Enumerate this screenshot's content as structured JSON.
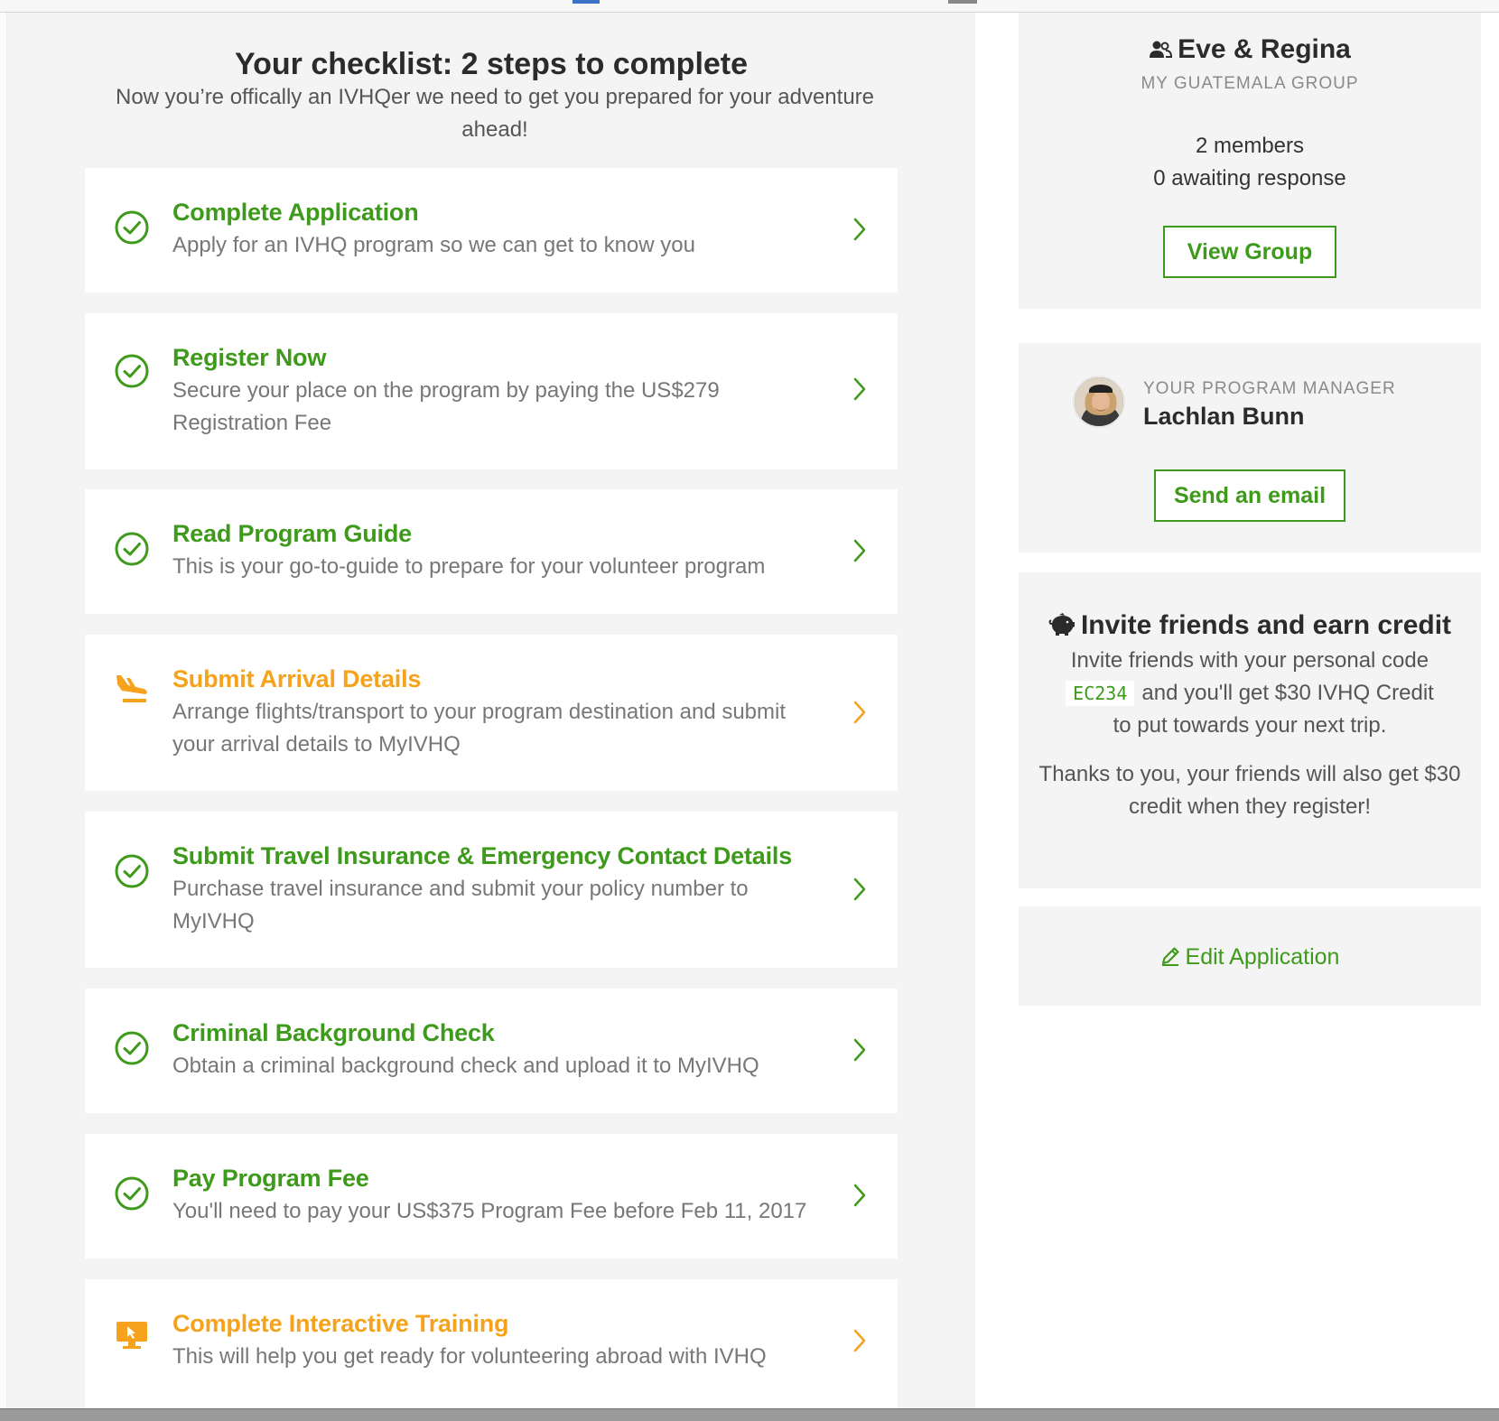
{
  "checklist": {
    "title": "Your checklist: 2 steps to complete",
    "subtitle": "Now you’re offically an IVHQer we need to get you prepared for your adventure ahead!",
    "items": [
      {
        "title": "Complete Application",
        "description": "Apply for an IVHQ program so we can get to know you",
        "status": "done"
      },
      {
        "title": "Register Now",
        "description": "Secure your place on the program by paying the US$279 Registration Fee",
        "status": "done"
      },
      {
        "title": "Read Program Guide",
        "description": "This is your go-to-guide to prepare for your volunteer program",
        "status": "done"
      },
      {
        "title": "Submit Arrival Details",
        "description": "Arrange flights/transport to your program destination and submit your arrival details to MyIVHQ",
        "status": "todo"
      },
      {
        "title": "Submit Travel Insurance & Emergency Contact Details",
        "description": "Purchase travel insurance and submit your policy number to MyIVHQ",
        "status": "done"
      },
      {
        "title": "Criminal Background Check",
        "description": "Obtain a criminal background check and upload it to MyIVHQ",
        "status": "done"
      },
      {
        "title": "Pay Program Fee",
        "description": "You'll need to pay your US$375 Program Fee before Feb 11, 2017",
        "status": "done"
      },
      {
        "title": "Complete Interactive Training",
        "description": "This will help you get ready for volunteering abroad with IVHQ",
        "status": "todo"
      }
    ]
  },
  "group": {
    "name": "Eve & Regina",
    "label": "MY GUATEMALA GROUP",
    "members": "2 members",
    "awaiting": "0 awaiting response",
    "button_label": "View Group"
  },
  "program_manager": {
    "label": "YOUR PROGRAM MANAGER",
    "name": "Lachlan Bunn",
    "button_label": "Send an email"
  },
  "invite": {
    "title": "Invite friends and earn credit",
    "line1": "Invite friends with your personal code",
    "code": "EC234",
    "line2": "and you'll get $30 IVHQ Credit",
    "line3": "to put towards your next trip.",
    "thanks": "Thanks to you, your friends will also get $30 credit when they register!"
  },
  "edit_application": {
    "label": "Edit Application"
  },
  "colors": {
    "done_green": "#3e9a1b",
    "todo_orange": "#f6a21c",
    "panel_gray": "#f4f4f4"
  },
  "icons": {
    "done": "check-circle-icon",
    "arrival": "plane-landing-icon",
    "training": "monitor-cursor-icon",
    "chevron": "chevron-right-icon"
  }
}
